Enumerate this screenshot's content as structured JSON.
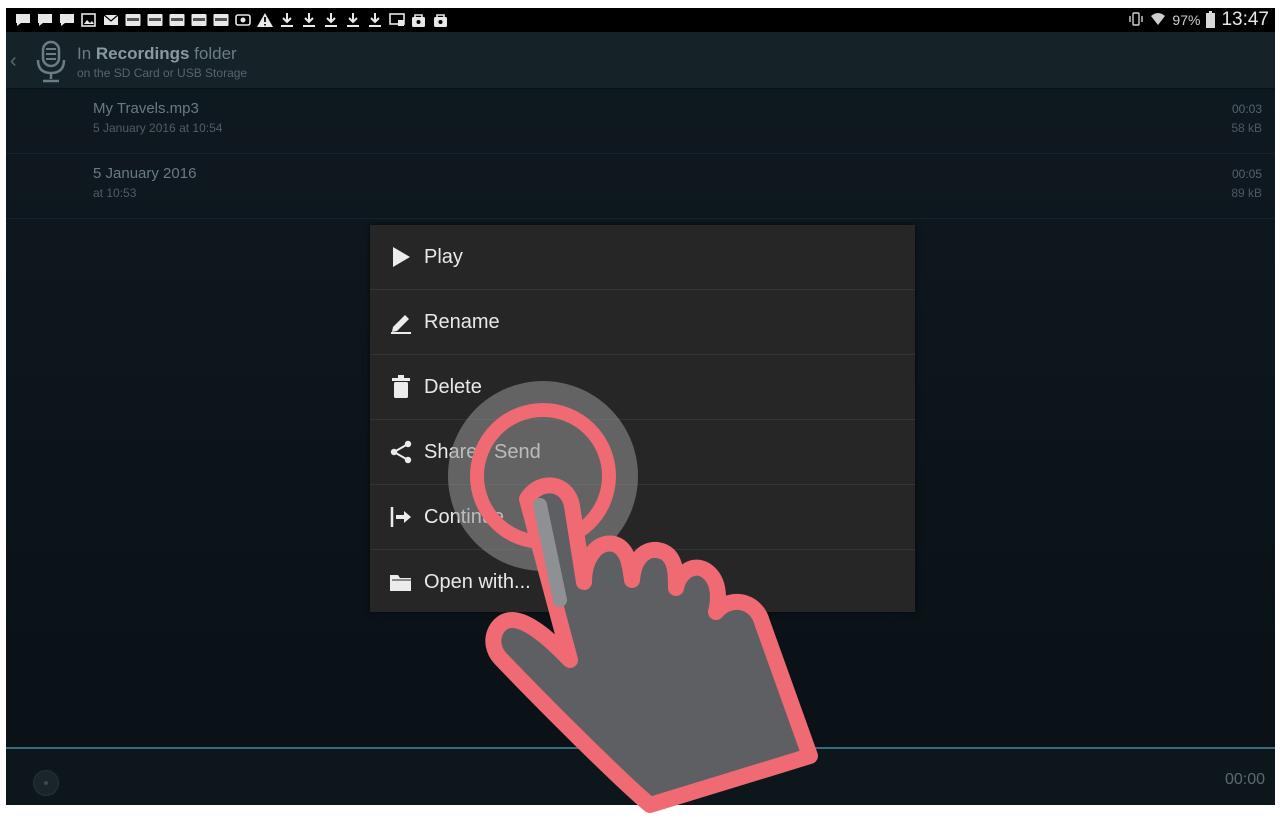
{
  "status_bar": {
    "notification_icons": [
      "chat-icon",
      "chat-icon",
      "chat-icon",
      "image-icon",
      "mail-icon",
      "app-icon",
      "app-icon",
      "app-icon",
      "app-icon",
      "app-icon",
      "screenshot-icon",
      "warning-icon",
      "download-icon",
      "download-icon",
      "download-icon",
      "download-icon",
      "download-icon",
      "cast-icon",
      "bag-icon",
      "bag-icon"
    ],
    "battery": "97%",
    "time": "13:47"
  },
  "header": {
    "title_prefix": "In ",
    "title_bold": "Recordings",
    "title_suffix": " folder",
    "subtitle": "on the SD Card or USB Storage"
  },
  "recordings": [
    {
      "name": "My Travels.mp3",
      "date": "5 January 2016 at 10:54",
      "duration": "00:03",
      "size": "58 kB"
    },
    {
      "name": "5 January 2016",
      "date": "at 10:53",
      "duration": "00:05",
      "size": "89 kB"
    }
  ],
  "context_menu": {
    "items": [
      {
        "label": "Play",
        "icon": "play-icon"
      },
      {
        "label": "Rename",
        "icon": "pencil-icon"
      },
      {
        "label": "Delete",
        "icon": "trash-icon"
      },
      {
        "label": "Share / Send",
        "icon": "share-icon"
      },
      {
        "label": "Continue",
        "icon": "continue-icon"
      },
      {
        "label": "Open with...",
        "icon": "folder-icon"
      }
    ]
  },
  "bottom_bar": {
    "time": "00:00"
  },
  "colors": {
    "accent_line": "#3a6a7e",
    "hand_outline": "#ef6a72",
    "menu_bg": "#262626"
  }
}
